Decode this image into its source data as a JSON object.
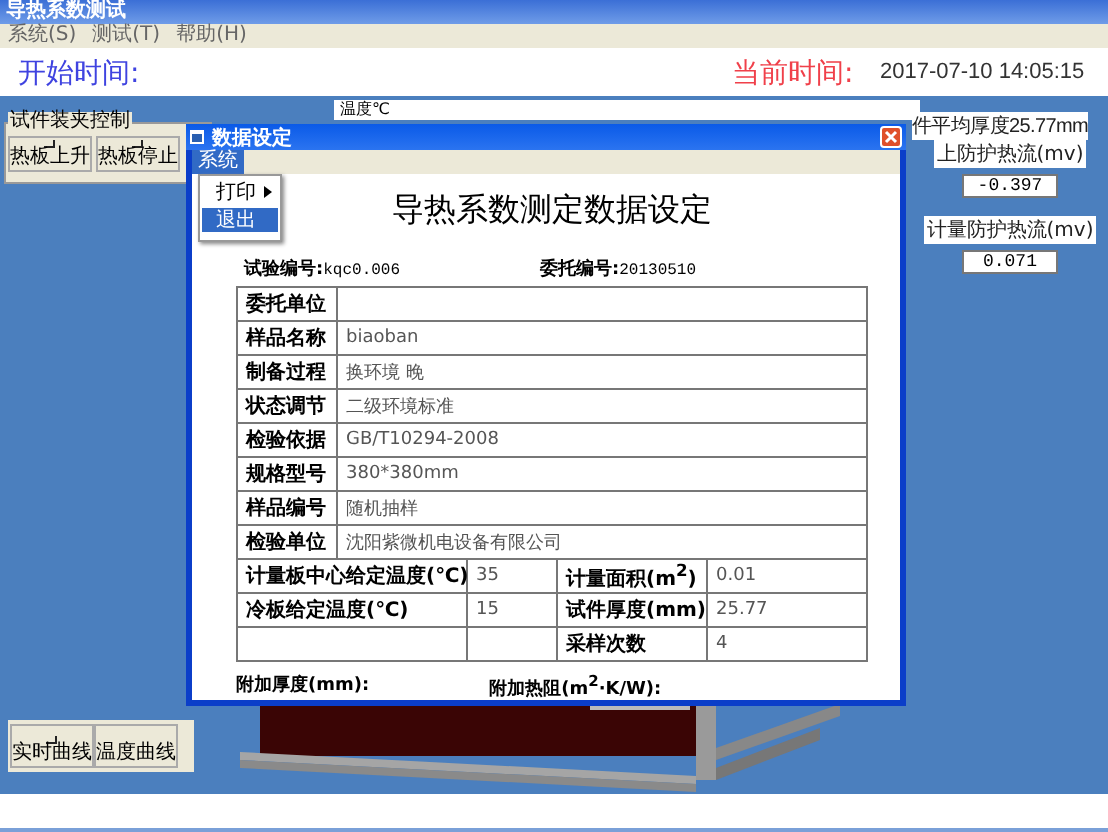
{
  "window": {
    "title": "导热系数测试"
  },
  "menu": [
    "系统(S)",
    "测试(T)",
    "帮助(H)"
  ],
  "header": {
    "start_label": "开始时间:",
    "current_label": "当前时间:",
    "current_time": "2017-07-10 14:05:15"
  },
  "chart_label": "温度℃",
  "clamp_group": {
    "title": "试件装夹控制",
    "buttons": [
      "热板上升",
      "热板停止"
    ]
  },
  "readouts": {
    "thickness": "件平均厚度25.77mm",
    "items": [
      {
        "label": "上防护热流(mv)",
        "value": "-0.397"
      },
      {
        "label": "计量防护热流(mv)",
        "value": "0.071"
      }
    ]
  },
  "curve_buttons": [
    "实时曲线",
    "温度曲线"
  ],
  "dialog": {
    "title": "数据设定",
    "menu": [
      {
        "label": "系统",
        "selected": true
      }
    ],
    "dropdown": [
      {
        "label": "打印",
        "submenu": true,
        "selected": false
      },
      {
        "label": "退出",
        "submenu": false,
        "selected": true
      }
    ],
    "heading": "导热系数测定数据设定",
    "test_no_label": "试验编号:",
    "test_no": "kqc0.006",
    "entrust_no_label": "委托编号:",
    "entrust_no": "20130510",
    "rows": [
      {
        "label": "委托单位"
      },
      {
        "label": "样品名称",
        "value": "biaoban"
      },
      {
        "label": "制备过程",
        "value": "换环境 晚"
      },
      {
        "label": "状态调节",
        "value": "二级环境标准"
      },
      {
        "label": "检验依据",
        "value": "GB/T10294-2008"
      },
      {
        "label": "规格型号",
        "value": "380*380mm"
      },
      {
        "label": "样品编号",
        "value": "随机抽样"
      },
      {
        "label": "检验单位",
        "value": "沈阳紫微机电设备有限公司"
      }
    ],
    "params": [
      {
        "left": {
          "label": "计量板中心给定温度(℃)",
          "value": "35"
        },
        "right": {
          "label": "计量面积(m$^{2}$)",
          "value": "0.01"
        }
      },
      {
        "left": {
          "label": "冷板给定温度(℃)",
          "value": "15"
        },
        "right": {
          "label": "试件厚度(mm)",
          "value": "25.77"
        }
      },
      {
        "right": {
          "label": "采样次数",
          "value": "4"
        }
      }
    ],
    "footer": [
      "附加厚度(mm):",
      "附加热阻(m$^{2}$·K/W):"
    ]
  }
}
